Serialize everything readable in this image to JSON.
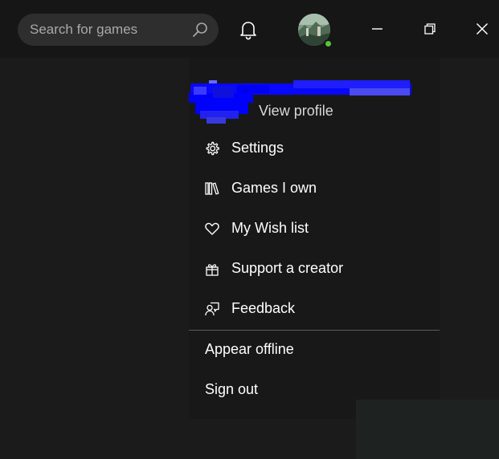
{
  "search": {
    "placeholder": "Search for games",
    "value": ""
  },
  "header": {
    "icons": [
      "search-icon",
      "bell-icon",
      "avatar",
      "minimize-icon",
      "restore-icon",
      "close-icon"
    ],
    "presence_color": "#57c33c"
  },
  "profile_menu": {
    "view_profile": "View profile",
    "items": [
      {
        "label": "Settings",
        "icon": "gear-icon"
      },
      {
        "label": "Games I own",
        "icon": "library-icon"
      },
      {
        "label": "My Wish list",
        "icon": "heart-icon"
      },
      {
        "label": "Support a creator",
        "icon": "gift-icon"
      },
      {
        "label": "Feedback",
        "icon": "feedback-icon"
      }
    ],
    "status_items": [
      {
        "label": "Appear offline"
      },
      {
        "label": "Sign out"
      }
    ]
  },
  "colors": {
    "background": "#1b1b1b",
    "titlebar": "#161616",
    "menu": "#181818",
    "redaction": "#0000ff"
  }
}
